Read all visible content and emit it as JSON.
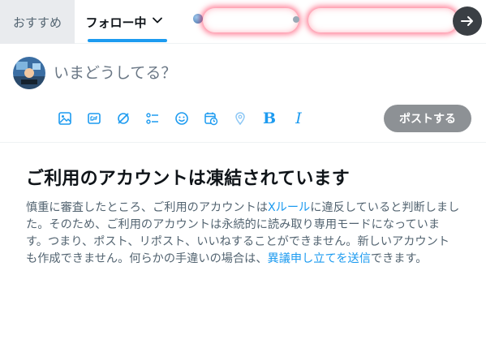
{
  "tabs": {
    "recommended_label": "おすすめ",
    "following_label": "フォロー中"
  },
  "icons": {
    "following_dropdown": "chevron-down-icon",
    "scroll_right": "arrow-right-icon",
    "toolbar": [
      "image-icon",
      "gif-icon",
      "grok-icon",
      "poll-icon",
      "emoji-icon",
      "schedule-icon",
      "location-icon",
      "bold-icon",
      "italic-icon"
    ]
  },
  "composer": {
    "placeholder": "いまどうしてる？",
    "post_label": "ポストする",
    "bold_glyph": "B",
    "italic_glyph": "I"
  },
  "notice": {
    "title": "ご利用のアカウントは凍結されています",
    "body_part1": "慎重に審査したところ、ご利用のアカウントは",
    "rules_link": "Xルール",
    "body_part2": "に違反していると判断しました。そのため、ご利用のアカウントは永続的に読み取り専用モードになっています。つまり、ポスト、リポスト、いいねすることができません。新しいアカウントも作成できません。何らかの手違いの場合は、",
    "appeal_link": "異議申し立てを送信",
    "body_part3": "できます。"
  },
  "colors": {
    "accent": "#1d9bf0",
    "post_button_disabled": "#8d9195",
    "text_primary": "#0f1419",
    "text_secondary": "#536471"
  }
}
